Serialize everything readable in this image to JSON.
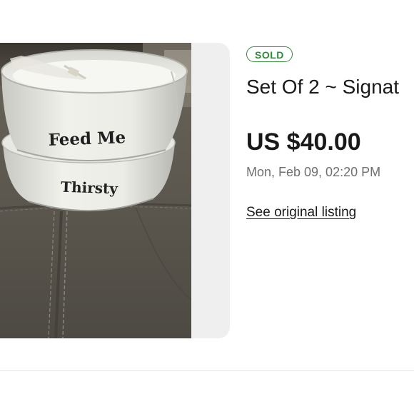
{
  "listing": {
    "status_badge": "SOLD",
    "title": "Set Of 2 ~ Signat",
    "price": "US $40.00",
    "sold_date": "Mon, Feb 09, 02:20 PM",
    "see_original_label": "See original listing"
  },
  "photo": {
    "upper_bowl_text": "Feed Me",
    "lower_bowl_text": "Thirsty"
  },
  "colors": {
    "sold_green": "#2e8c3b",
    "text_dark": "#191919",
    "text_muted": "#707070",
    "card_bg": "#efefef"
  }
}
